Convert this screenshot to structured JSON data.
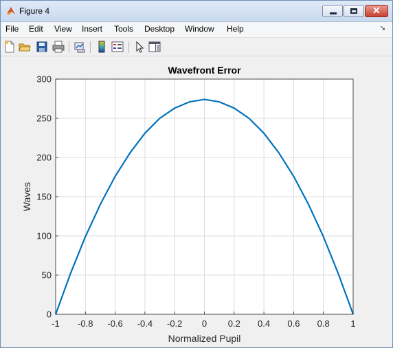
{
  "window": {
    "title": "Figure 4"
  },
  "menu": [
    "File",
    "Edit",
    "View",
    "Insert",
    "Tools",
    "Desktop",
    "Window",
    "Help"
  ],
  "toolbar": {
    "icons": [
      "new-figure-icon",
      "open-file-icon",
      "save-icon",
      "print-icon",
      "link-plot-icon",
      "colorbar-icon",
      "legend-icon",
      "pointer-icon",
      "property-editor-icon"
    ]
  },
  "chart_data": {
    "type": "line",
    "title": "Wavefront Error",
    "xlabel": "Normalized Pupil",
    "ylabel": "Waves",
    "xlim": [
      -1,
      1
    ],
    "ylim": [
      0,
      300
    ],
    "xticks": [
      "-1",
      "-0.8",
      "-0.6",
      "-0.4",
      "-0.2",
      "0",
      "0.2",
      "0.4",
      "0.6",
      "0.8",
      "1"
    ],
    "yticks": [
      "0",
      "50",
      "100",
      "150",
      "200",
      "250",
      "300"
    ],
    "grid": true,
    "series": [
      {
        "color": "#0072bd",
        "x": [
          -1,
          -0.9,
          -0.8,
          -0.7,
          -0.6,
          -0.5,
          -0.4,
          -0.3,
          -0.2,
          -0.1,
          0,
          0.1,
          0.2,
          0.3,
          0.4,
          0.5,
          0.6,
          0.7,
          0.8,
          0.9,
          1
        ],
        "y": [
          0,
          52,
          99,
          140,
          176,
          206,
          231,
          250,
          263,
          271,
          274,
          271,
          263,
          250,
          231,
          206,
          176,
          140,
          99,
          52,
          0
        ]
      }
    ]
  }
}
